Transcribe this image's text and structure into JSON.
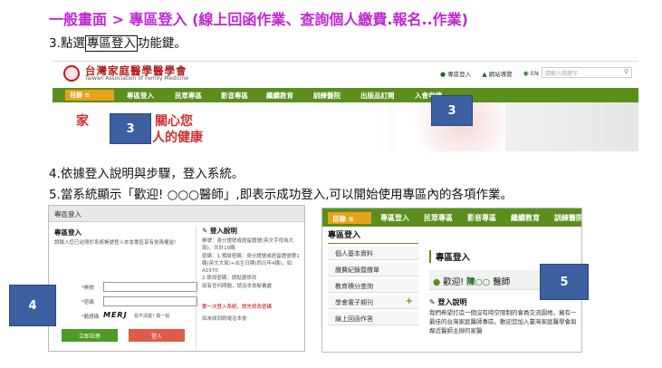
{
  "title": "一般畫面 > 專區登入 (線上回函作業、查詢個人繳費.報名..作業)",
  "step3": {
    "prefix": "3.點選",
    "boxed": "專區登入",
    "suffix": "功能鍵。"
  },
  "step4": "4.依據登入說明與步驟，登入系統。",
  "step5": "5.當系統顯示「歡迎! ○○○醫師」,即表示成功登入,可以開始使用專區內的各項作業。",
  "shot1": {
    "logo_zh": "台灣家庭醫學醫學會",
    "logo_en": "Taiwan Association of Family Medicine",
    "header_links": [
      "專區登入",
      "網站導覽",
      "EN"
    ],
    "search_placeholder": "請輸入關鍵字",
    "menu_label": "目錄 ≡",
    "nav": [
      "專區登入",
      "民眾專區",
      "影音專區",
      "繼續教育",
      "訓練醫院",
      "出版品訂閱",
      "入會申請"
    ],
    "banner_part1": "家",
    "banner_part2": "關心您",
    "banner_part3": "人的健康",
    "callouts": [
      "3",
      "3"
    ]
  },
  "shot2": {
    "header": "專區登入",
    "login_heading": "專區登入",
    "login_hint": "請輸入您已註冊於系統帳號登入本會專區享有會員權益!",
    "fields": [
      "*帳號",
      "*密碼",
      "*驗證碼"
    ],
    "captcha": "MERJ",
    "captcha_refresh": "看不清楚? 換一張",
    "btn_register": "立即註冊",
    "btn_login": "登入",
    "guide_heading": "登入說明",
    "guide_lines": [
      "帳號：身分證號或居留證號(英文字母為大寫)，共計10碼",
      "密碼：1.預設密碼：身分證號或居留證號第1碼(英文大寫)+出生日期(西元年4碼)，如A1970",
      "2.修改密碼：請點選修改",
      "如有任何問題，請洽本會秘書處"
    ],
    "guide_note": "第一次登入系統，請先修改密碼",
    "guide_footer": "如未收到請電洽本會",
    "callout": "4"
  },
  "shot3": {
    "menu_label": "目錄 ≡",
    "nav": [
      "專區登入",
      "民眾專區",
      "影音專區",
      "繼續教育",
      "訓練醫院"
    ],
    "side_heading": "專區登入",
    "side_items": [
      "個人基本資料",
      "繳費紀錄暨繳單",
      "教育積分查詢",
      "學會電子期刊",
      "線上回函作答"
    ],
    "main_heading": "專區登入",
    "welcome_prefix": "歡迎!",
    "welcome_name": "陳○○",
    "welcome_suffix": "醫師",
    "guide_heading": "登入說明",
    "guide_text": "我們希望打造一個沒有時空限制的會員交流園地，擁有一最佳的台灣家庭醫師專區。歡迎您加入臺灣家庭醫學會與鄰近醫師主辦的家醫",
    "callout": "5"
  }
}
